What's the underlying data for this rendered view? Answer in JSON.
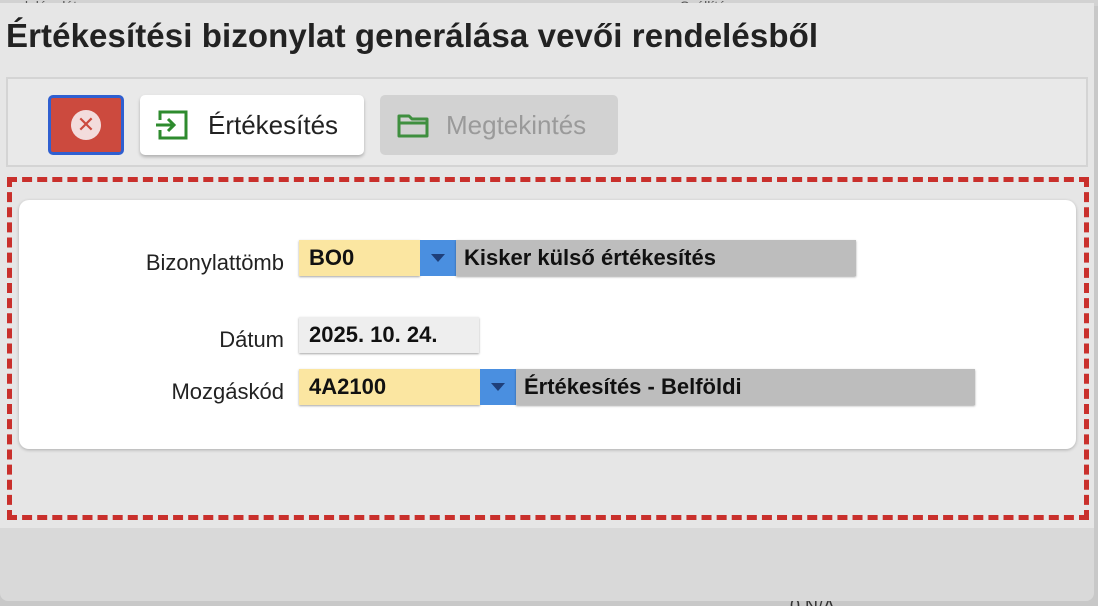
{
  "dialog": {
    "title": "Értékesítési bizonylat generálása vevői rendelésből"
  },
  "toolbar": {
    "sale_label": "Értékesítés",
    "view_label": "Megtekintés",
    "close_glyph": "✕"
  },
  "form": {
    "doc_block": {
      "label": "Bizonylattömb",
      "code": "BO0",
      "description": "Kisker külső értékesítés"
    },
    "date": {
      "label": "Dátum",
      "value": "2025. 10. 24."
    },
    "movement": {
      "label": "Mozgáskód",
      "code": "4A2100",
      "description": "Értékesítés - Belföldi"
    }
  },
  "background": {
    "top_left_fragment": "rendelés dátuma",
    "top_mid_fragment": "Szállítás",
    "bottom_fragment": "0 N/A"
  },
  "colors": {
    "close_button": "#cc4a3e",
    "focus_border": "#2f5fd0",
    "dropdown_button": "#4a8fe0",
    "code_field": "#fbe6a1",
    "dashed_border": "#c9302c",
    "sale_icon": "#2e8b2e"
  },
  "icons": {
    "close": "close-circle-icon",
    "sale": "enter-arrow-icon",
    "view": "folder-icon",
    "dropdown": "caret-down-icon"
  }
}
